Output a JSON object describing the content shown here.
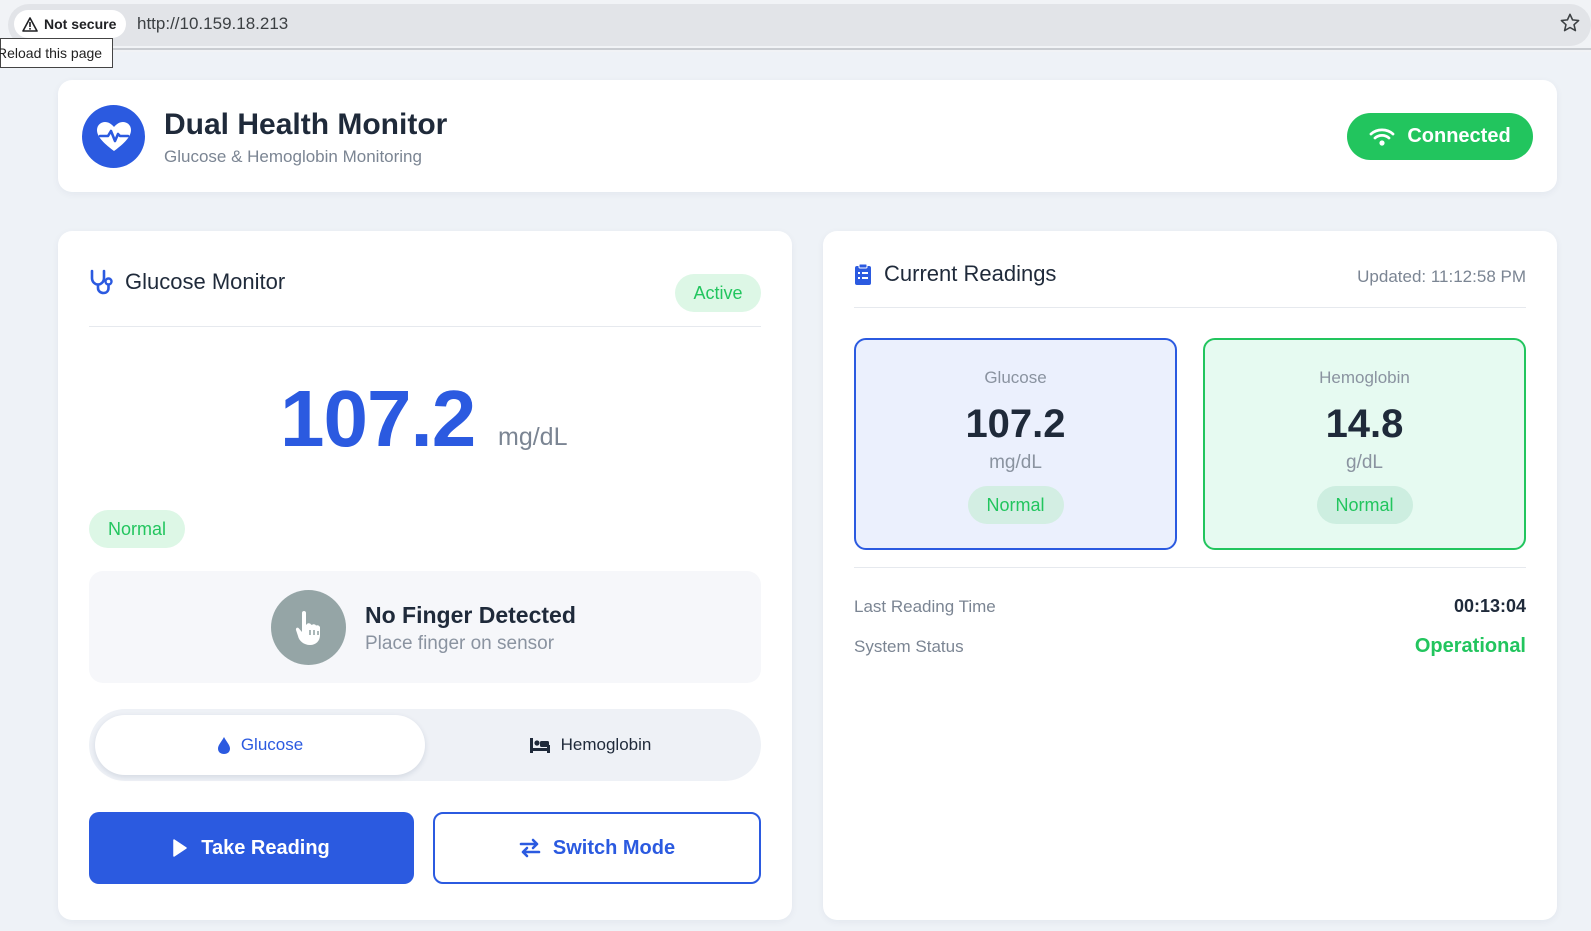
{
  "browser": {
    "security_label": "Not secure",
    "url": "http://10.159.18.213",
    "tooltip": "Reload this page"
  },
  "header": {
    "title": "Dual Health Monitor",
    "subtitle": "Glucose & Hemoglobin Monitoring",
    "connection_status": "Connected"
  },
  "glucose_monitor": {
    "title": "Glucose Monitor",
    "state_badge": "Active",
    "value": "107.2",
    "unit": "mg/dL",
    "status": "Normal",
    "finger": {
      "title": "No Finger Detected",
      "subtitle": "Place finger on sensor"
    },
    "modes": [
      {
        "label": "Glucose",
        "selected": true
      },
      {
        "label": "Hemoglobin",
        "selected": false
      }
    ],
    "take_reading_label": "Take Reading",
    "switch_mode_label": "Switch Mode"
  },
  "current_readings": {
    "title": "Current Readings",
    "updated": "Updated: 11:12:58 PM",
    "glucose": {
      "label": "Glucose",
      "value": "107.2",
      "unit": "mg/dL",
      "status": "Normal"
    },
    "hemoglobin": {
      "label": "Hemoglobin",
      "value": "14.8",
      "unit": "g/dL",
      "status": "Normal"
    },
    "last_reading_label": "Last Reading Time",
    "last_reading_value": "00:13:04",
    "system_status_label": "System Status",
    "system_status_value": "Operational"
  },
  "colors": {
    "primary": "#2b5ae0",
    "success": "#22c55e",
    "background": "#eef2f7"
  }
}
